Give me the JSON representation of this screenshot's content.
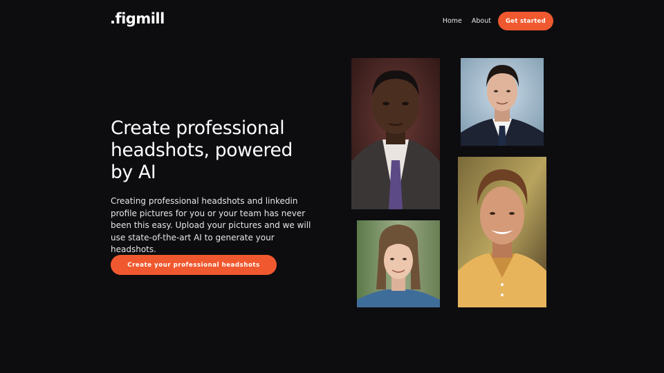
{
  "header": {
    "logo": ".figmill",
    "nav": [
      {
        "label": "Home"
      },
      {
        "label": "About"
      }
    ],
    "cta_label": "Get started"
  },
  "hero": {
    "title": "Create professional headshots, powered by AI",
    "description": "Creating professional headshots and linkedin profile pictures for you or your team has never been this easy. Upload your pictures and we will use state-of-the-art AI to generate your headshots.",
    "cta_label": "Create your professional headshots"
  },
  "colors": {
    "background": "#0d0d10",
    "accent": "#f0592f",
    "text": "#ffffff"
  },
  "photos": [
    {
      "name": "headshot-man-suit-purple-tie"
    },
    {
      "name": "headshot-man-navy-suit"
    },
    {
      "name": "headshot-man-yellow-polo"
    },
    {
      "name": "headshot-woman-denim-jacket"
    }
  ]
}
